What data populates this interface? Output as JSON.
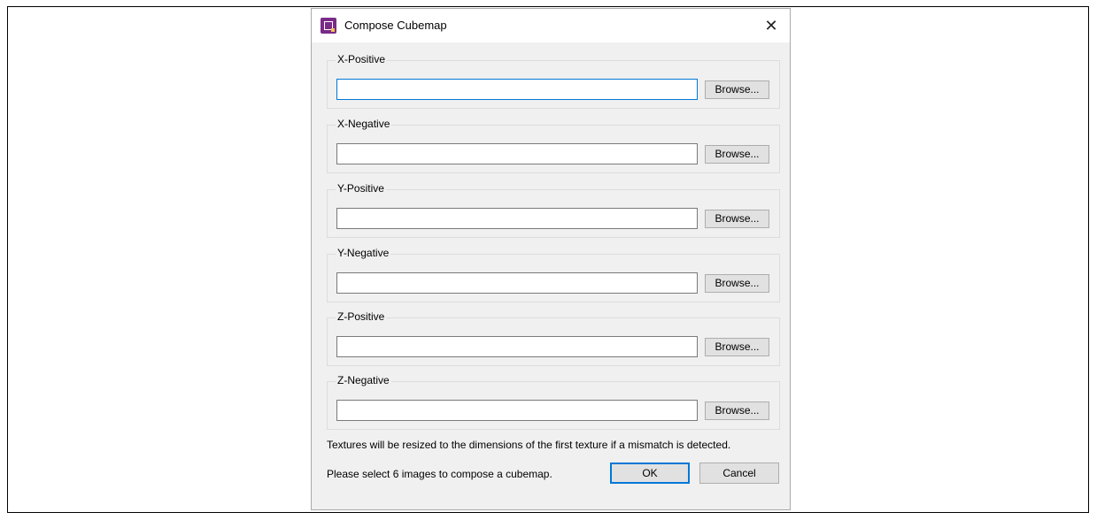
{
  "dialog": {
    "title": "Compose Cubemap",
    "close_glyph": "✕",
    "app_icon": "cubemap-app-icon"
  },
  "faces": [
    {
      "label": "X-Positive",
      "value": "",
      "browse_label": "Browse..."
    },
    {
      "label": "X-Negative",
      "value": "",
      "browse_label": "Browse..."
    },
    {
      "label": "Y-Positive",
      "value": "",
      "browse_label": "Browse..."
    },
    {
      "label": "Y-Negative",
      "value": "",
      "browse_label": "Browse..."
    },
    {
      "label": "Z-Positive",
      "value": "",
      "browse_label": "Browse..."
    },
    {
      "label": "Z-Negative",
      "value": "",
      "browse_label": "Browse..."
    }
  ],
  "note": "Textures will be resized to the dimensions of the first texture if a mismatch is detected.",
  "status": "Please select 6 images to compose a cubemap.",
  "buttons": {
    "ok": "OK",
    "cancel": "Cancel"
  },
  "colors": {
    "focus_accent": "#0078d7",
    "dialog_bg": "#f0f0f0",
    "icon_bg": "#7a2a87"
  }
}
